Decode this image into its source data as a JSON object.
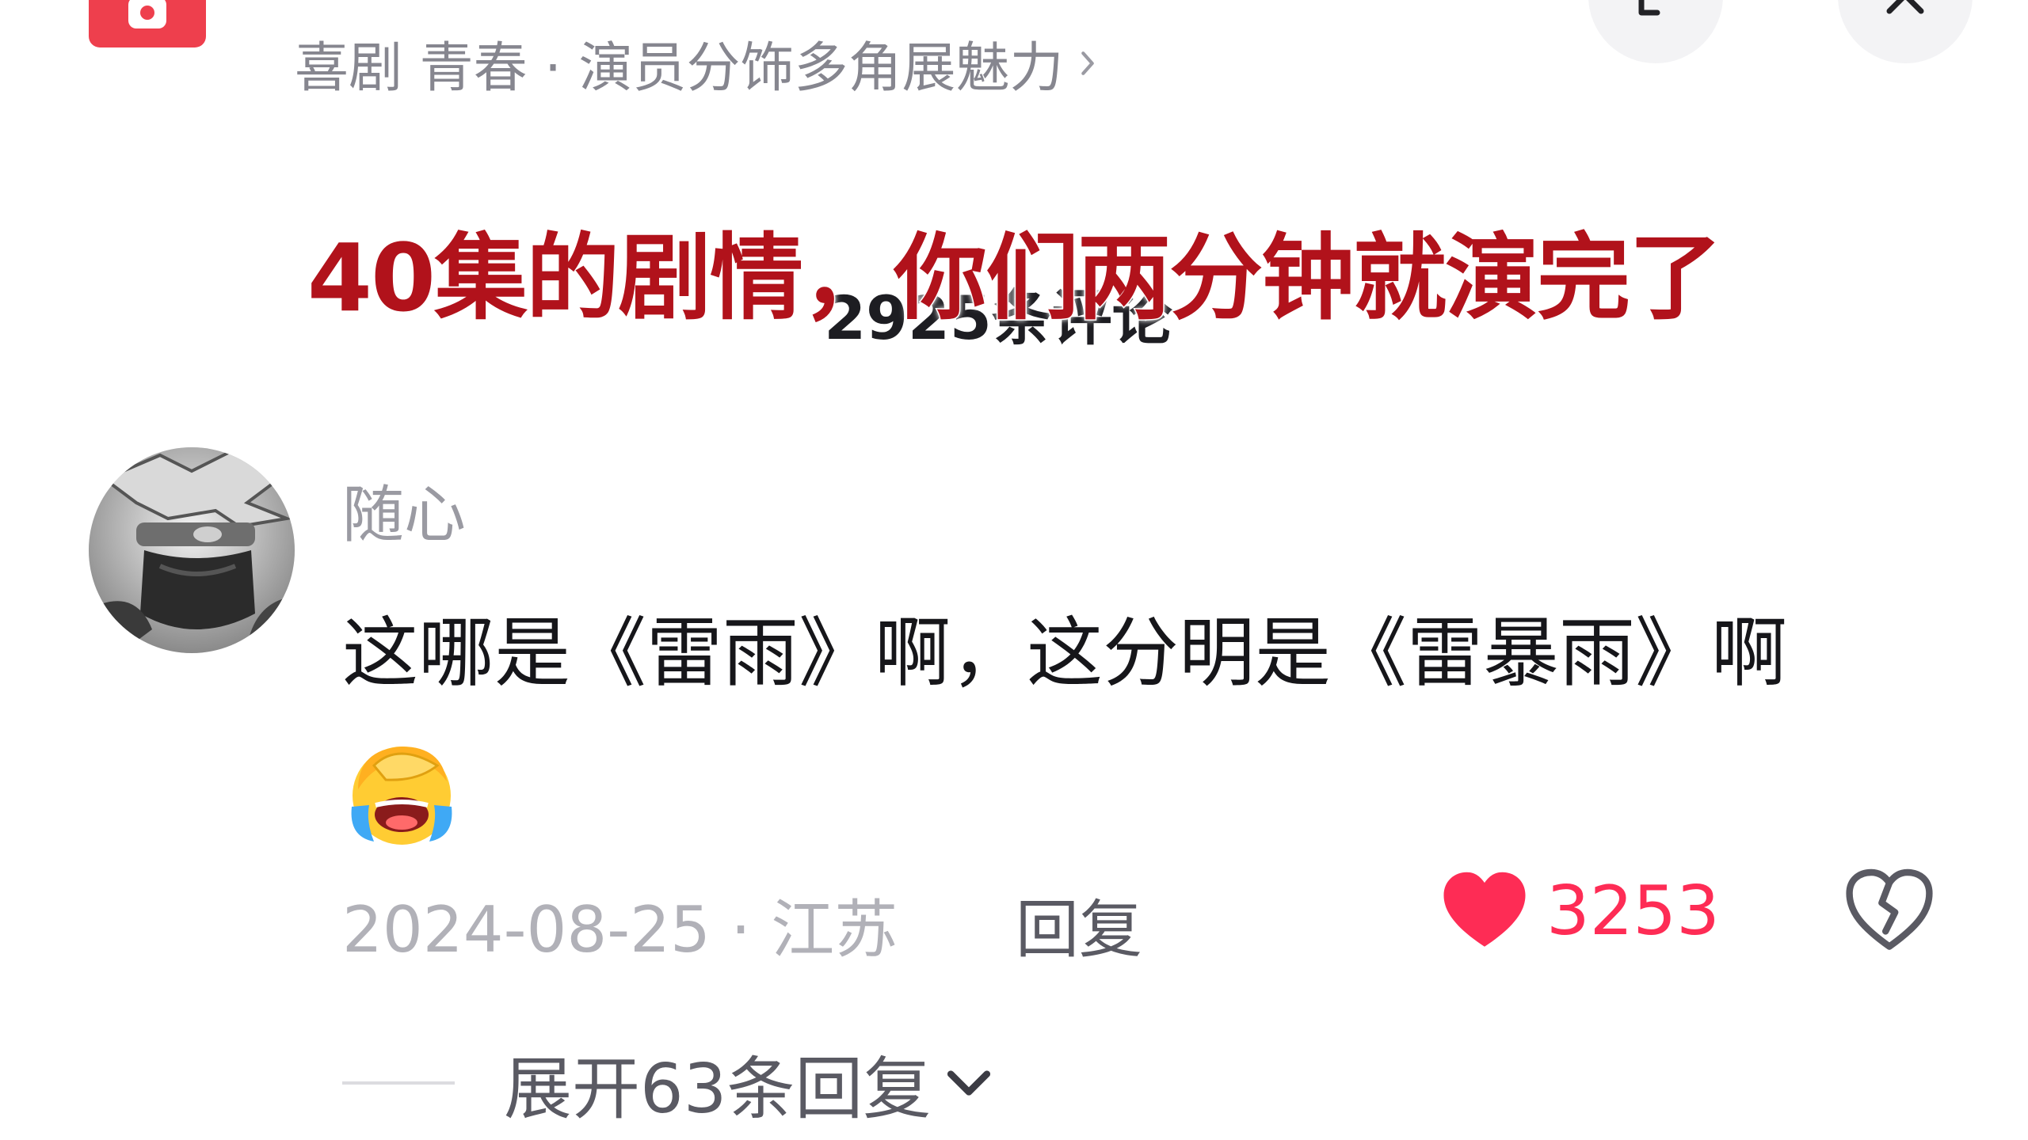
{
  "header": {
    "tags_text": "喜剧 青春 · 演员分饰多角展魅力"
  },
  "overlay": {
    "caption": "40集的剧情，你们两分钟就演完了"
  },
  "comments_header": {
    "count_label": "2925条评论"
  },
  "comment": {
    "username": "随心",
    "text": "这哪是《雷雨》啊，这分明是《雷暴雨》啊",
    "emoji": "face-palm-laugh-cry-emoji",
    "date": "2024-08-25",
    "separator": " · ",
    "location": "江苏",
    "reply_label": "回复",
    "like_count": "3253",
    "expand_replies_label": "展开63条回复"
  },
  "icons": {
    "app": "app-logo-icon",
    "expand": "expand-icon",
    "close": "close-icon",
    "like": "heart-icon",
    "dislike": "broken-heart-icon",
    "chevron": "chevron-down-icon"
  },
  "colors": {
    "caption": "#b1121b",
    "like": "#fe2c55",
    "app_icon": "#ee3f4d",
    "muted_text": "#9a9aa2"
  }
}
